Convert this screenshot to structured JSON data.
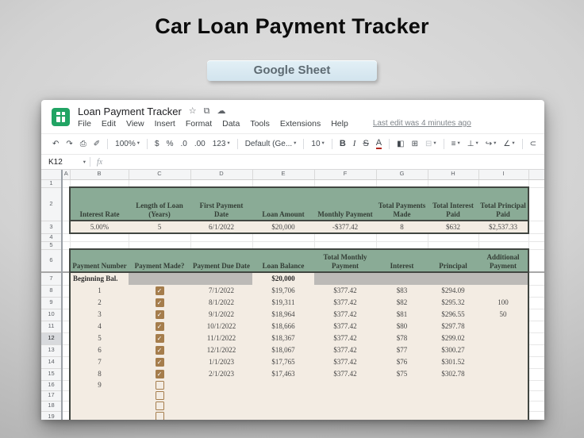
{
  "page": {
    "title": "Car Loan Payment Tracker",
    "badge_label": "Google Sheet"
  },
  "window": {
    "doc_title": "Loan Payment Tracker",
    "titlebar_icons": {
      "star": "☆",
      "move_folder": "⧉",
      "cloud": "☁"
    },
    "menus": [
      "File",
      "Edit",
      "View",
      "Insert",
      "Format",
      "Data",
      "Tools",
      "Extensions",
      "Help"
    ],
    "last_edit": "Last edit was 4 minutes ago",
    "name_box": "K12",
    "fx_label": "fx",
    "toolbar": [
      {
        "name": "undo-icon",
        "glyph": "↶"
      },
      {
        "name": "redo-icon",
        "glyph": "↷"
      },
      {
        "name": "print-icon",
        "glyph": "⎙"
      },
      {
        "name": "paint-format-icon",
        "glyph": "✐"
      },
      {
        "type": "sep"
      },
      {
        "name": "zoom-select",
        "glyph": "100%",
        "dd": true
      },
      {
        "type": "sep"
      },
      {
        "name": "format-currency-icon",
        "glyph": "$"
      },
      {
        "name": "format-percent-icon",
        "glyph": "%"
      },
      {
        "name": "decrease-decimal-icon",
        "glyph": ".0"
      },
      {
        "name": "increase-decimal-icon",
        "glyph": ".00"
      },
      {
        "name": "number-format-menu",
        "glyph": "123",
        "dd": true
      },
      {
        "type": "sep"
      },
      {
        "name": "font-select",
        "glyph": "Default (Ge...",
        "dd": true
      },
      {
        "type": "sep"
      },
      {
        "name": "font-size-select",
        "glyph": "10",
        "dd": true
      },
      {
        "type": "sep"
      },
      {
        "name": "bold-icon",
        "glyph": "B"
      },
      {
        "name": "italic-icon",
        "glyph": "I"
      },
      {
        "name": "strikethrough-icon",
        "glyph": "S"
      },
      {
        "name": "text-color-icon",
        "glyph": "A"
      },
      {
        "type": "sep"
      },
      {
        "name": "fill-color-icon",
        "glyph": "◧"
      },
      {
        "name": "borders-icon",
        "glyph": "⊞"
      },
      {
        "name": "merge-cells-icon",
        "glyph": "⊟",
        "dd": true
      },
      {
        "type": "sep"
      },
      {
        "name": "horizontal-align-icon",
        "glyph": "≡",
        "dd": true
      },
      {
        "name": "vertical-align-icon",
        "glyph": "⊥",
        "dd": true
      },
      {
        "name": "text-wrap-icon",
        "glyph": "↪",
        "dd": true
      },
      {
        "name": "text-rotation-icon",
        "glyph": "∠",
        "dd": true
      },
      {
        "type": "sep"
      },
      {
        "name": "link-icon",
        "glyph": "⊂"
      }
    ]
  },
  "sheet": {
    "column_letters": [
      "A",
      "B",
      "C",
      "D",
      "E",
      "F",
      "G",
      "H",
      "I",
      ""
    ],
    "row_count": 19,
    "selected_row_header": 12,
    "summary_table": {
      "headers": [
        "Interest Rate",
        "Length of Loan (Years)",
        "First Payment Date",
        "Loan Amount",
        "Monthly Payment",
        "Total Payments Made",
        "Total Interest Paid",
        "Total Principal Paid"
      ],
      "values": [
        "5.00%",
        "5",
        "6/1/2022",
        "$20,000",
        "-$377.42",
        "8",
        "$632",
        "$2,537.33"
      ]
    },
    "payment_table": {
      "headers": [
        "Payment Number",
        "Payment Made?",
        "Payment Due Date",
        "Loan Balance",
        "Total Monthly Payment",
        "Interest",
        "Principal",
        "Additional Payment"
      ],
      "beginning": {
        "label": "Beginning Bal.",
        "balance": "$20,000"
      },
      "rows": [
        {
          "num": "1",
          "made": true,
          "due": "7/1/2022",
          "balance": "$19,706",
          "payment": "$377.42",
          "interest": "$83",
          "principal": "$294.09",
          "additional": ""
        },
        {
          "num": "2",
          "made": true,
          "due": "8/1/2022",
          "balance": "$19,311",
          "payment": "$377.42",
          "interest": "$82",
          "principal": "$295.32",
          "additional": "100"
        },
        {
          "num": "3",
          "made": true,
          "due": "9/1/2022",
          "balance": "$18,964",
          "payment": "$377.42",
          "interest": "$81",
          "principal": "$296.55",
          "additional": "50"
        },
        {
          "num": "4",
          "made": true,
          "due": "10/1/2022",
          "balance": "$18,666",
          "payment": "$377.42",
          "interest": "$80",
          "principal": "$297.78",
          "additional": ""
        },
        {
          "num": "5",
          "made": true,
          "due": "11/1/2022",
          "balance": "$18,367",
          "payment": "$377.42",
          "interest": "$78",
          "principal": "$299.02",
          "additional": ""
        },
        {
          "num": "6",
          "made": true,
          "due": "12/1/2022",
          "balance": "$18,067",
          "payment": "$377.42",
          "interest": "$77",
          "principal": "$300.27",
          "additional": ""
        },
        {
          "num": "7",
          "made": true,
          "due": "1/1/2023",
          "balance": "$17,765",
          "payment": "$377.42",
          "interest": "$76",
          "principal": "$301.52",
          "additional": ""
        },
        {
          "num": "8",
          "made": true,
          "due": "2/1/2023",
          "balance": "$17,463",
          "payment": "$377.42",
          "interest": "$75",
          "principal": "$302.78",
          "additional": ""
        },
        {
          "num": "9",
          "made": false,
          "due": "",
          "balance": "",
          "payment": "",
          "interest": "",
          "principal": "",
          "additional": ""
        },
        {
          "num": "",
          "made": false,
          "due": "",
          "balance": "",
          "payment": "",
          "interest": "",
          "principal": "",
          "additional": ""
        },
        {
          "num": "",
          "made": false,
          "due": "",
          "balance": "",
          "payment": "",
          "interest": "",
          "principal": "",
          "additional": ""
        },
        {
          "num": "",
          "made": false,
          "due": "",
          "balance": "",
          "payment": "",
          "interest": "",
          "principal": "",
          "additional": ""
        }
      ]
    }
  },
  "colors": {
    "header_green": "#8aab96",
    "table_border_dark": "#414641",
    "row_beige": "#f3ece3",
    "gray_fill": "#bcbab7",
    "checkbox_brown": "#a57d4c",
    "sheets_logo_green": "#21a464",
    "badge_blue": "#d2e4ee",
    "badge_text": "#5d6a72"
  }
}
